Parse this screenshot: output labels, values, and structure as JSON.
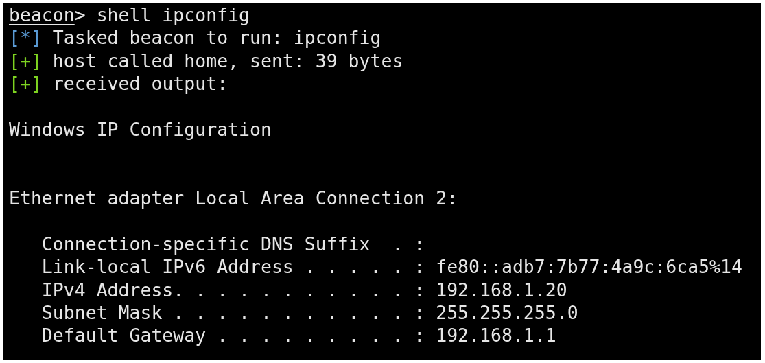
{
  "terminal": {
    "lines": [
      {
        "kind": "prompt",
        "prompt": "beacon",
        "command": "> shell ipconfig"
      },
      {
        "kind": "status",
        "marker": "[*]",
        "color": "#5b9bd5",
        "text": "Tasked beacon to run: ipconfig"
      },
      {
        "kind": "status",
        "marker": "[+]",
        "color": "#7ed321",
        "text": "host called home, sent: 39 bytes"
      },
      {
        "kind": "status",
        "marker": "[+]",
        "color": "#7ed321",
        "text": "received output:"
      },
      {
        "kind": "blank"
      },
      {
        "kind": "output",
        "text": "Windows IP Configuration"
      },
      {
        "kind": "blank"
      },
      {
        "kind": "blank"
      },
      {
        "kind": "output",
        "text": "Ethernet adapter Local Area Connection 2:"
      },
      {
        "kind": "blank"
      },
      {
        "kind": "entry",
        "text": "Connection-specific DNS Suffix  . :"
      },
      {
        "kind": "entry",
        "text": "Link-local IPv6 Address . . . . . : fe80::adb7:7b77:4a9c:6ca5%14"
      },
      {
        "kind": "entry",
        "text": "IPv4 Address. . . . . . . . . . . : 192.168.1.20"
      },
      {
        "kind": "entry",
        "text": "Subnet Mask . . . . . . . . . . . : 255.255.255.0"
      },
      {
        "kind": "entry",
        "text": "Default Gateway . . . . . . . . . : 192.168.1.1"
      }
    ]
  }
}
